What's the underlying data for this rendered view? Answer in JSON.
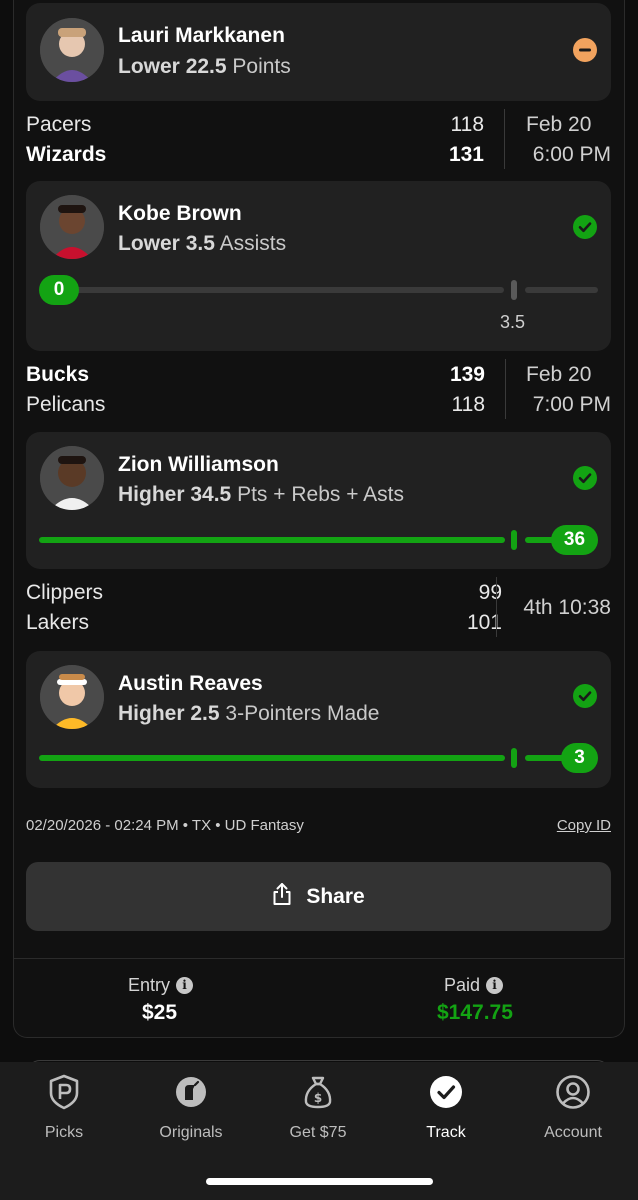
{
  "picks": [
    {
      "name": "Lauri Markkanen",
      "direction": "Lower",
      "line": "22.5",
      "stat": "Points",
      "status": "push",
      "status_color": "#f2a35e"
    },
    {
      "name": "Kobe Brown",
      "direction": "Lower",
      "line": "3.5",
      "stat": "Assists",
      "status": "won",
      "status_color": "#13a313",
      "current": "0",
      "line_label": "3.5",
      "progress": 0
    },
    {
      "name": "Zion Williamson",
      "direction": "Higher",
      "line": "34.5",
      "stat": "Pts + Rebs + Asts",
      "status": "won",
      "status_color": "#13a313",
      "current": "36",
      "progress": 1
    },
    {
      "name": "Austin Reaves",
      "direction": "Higher",
      "line": "2.5",
      "stat": "3-Pointers Made",
      "status": "won",
      "status_color": "#13a313",
      "current": "3",
      "progress": 1
    }
  ],
  "games": [
    {
      "team1": "Pacers",
      "score1": "118",
      "team2": "Wizards",
      "score2": "131",
      "time1": "Feb 20",
      "time2": "6:00 PM",
      "winner": 2
    },
    {
      "team1": "Bucks",
      "score1": "139",
      "team2": "Pelicans",
      "score2": "118",
      "time1": "Feb 20",
      "time2": "7:00 PM",
      "winner": 1
    },
    {
      "team1": "Clippers",
      "score1": "99",
      "team2": "Lakers",
      "score2": "101",
      "time1": "4th 10:38",
      "winner": 0
    }
  ],
  "meta": {
    "text": "02/20/2026 - 02:24 PM • TX • UD Fantasy",
    "copy_id": "Copy ID"
  },
  "share": {
    "label": "Share",
    "icon": "share-icon"
  },
  "summary": {
    "entry_label": "Entry",
    "entry_value": "$25",
    "paid_label": "Paid",
    "paid_value": "$147.75",
    "paid_color": "#13a313",
    "info_icon": "info-icon"
  },
  "tabs": [
    {
      "label": "Picks",
      "icon": "picks-icon"
    },
    {
      "label": "Originals",
      "icon": "originals-icon"
    },
    {
      "label": "Get $75",
      "icon": "money-bag-icon"
    },
    {
      "label": "Track",
      "icon": "check-circle-icon",
      "active": true
    },
    {
      "label": "Account",
      "icon": "user-circle-icon"
    }
  ]
}
